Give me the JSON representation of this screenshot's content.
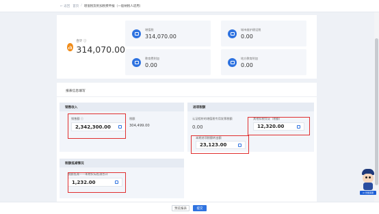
{
  "header": {
    "back_label": "← 返回",
    "breadcrumb_parent": "首页",
    "breadcrumb_sep": "/",
    "breadcrumb_current": "增值税及附加税费申报（一般纳税人适用）"
  },
  "summary": {
    "total_label": "合计 ⓘ",
    "total_value": "314,070.00",
    "stats": [
      {
        "label": "增值税",
        "value": "314,070.00"
      },
      {
        "label": "城市维护建设税",
        "value": "0.00"
      },
      {
        "label": "教育费附加",
        "value": "0.00"
      },
      {
        "label": "地方教育附加",
        "value": "0.00"
      }
    ]
  },
  "main": {
    "section_title": "报表信息填写",
    "sales_panel": {
      "title": "销售收入",
      "sales_label": "销售额 ⓘ",
      "sales_value": "2,342,300.00",
      "tax_label": "税额",
      "tax_value": "304,499.00"
    },
    "input_panel": {
      "title": "进项税额",
      "certified_label": "认证相符的增值税专用发票税额",
      "certified_value": "0.00",
      "other_label": "其他扣税凭证（税额）",
      "other_value": "12,320.00",
      "transfer_label": "本期进项税额转出额",
      "transfer_value": "23,123.00"
    },
    "reduction_panel": {
      "title": "税额抵减情况",
      "reduce_label": "税额抵减——本期实际抵减合计",
      "reduce_value": "1,232.00"
    }
  },
  "footer": {
    "prev_label": "预览报表",
    "next_label": "提交"
  },
  "mascot": {
    "tag_text": "AI 智能客服"
  },
  "colors": {
    "accent": "#2f73e0",
    "highlight": "#e02e2e",
    "total_icon": "#f08c1a"
  }
}
